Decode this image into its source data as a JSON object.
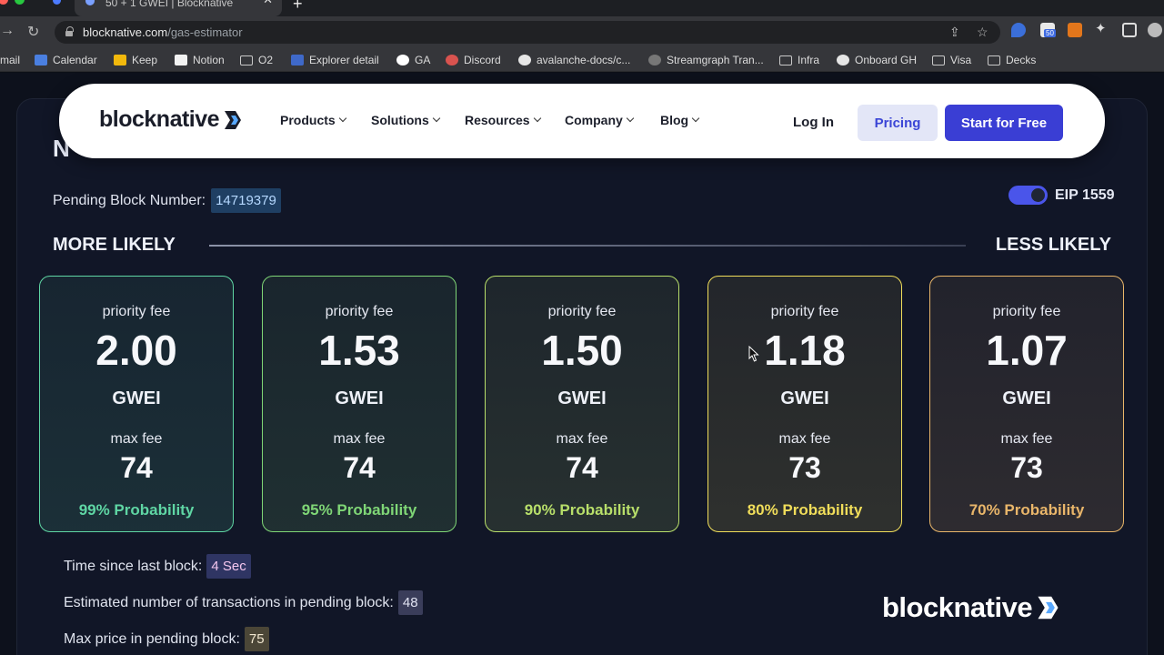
{
  "browser": {
    "tab_title": "50 + 1 GWEI | Blocknative",
    "url_host": "blocknative.com",
    "url_path": "/gas-estimator",
    "extension_badge": "50",
    "bookmarks": [
      {
        "label": "mail",
        "icon": "gmail-icon"
      },
      {
        "label": "Calendar",
        "icon": "calendar-icon"
      },
      {
        "label": "Keep",
        "icon": "keep-icon"
      },
      {
        "label": "Notion",
        "icon": "notion-icon"
      },
      {
        "label": "O2",
        "icon": "folder-icon"
      },
      {
        "label": "Explorer detail",
        "icon": "explorer-icon"
      },
      {
        "label": "GA",
        "icon": "google-icon"
      },
      {
        "label": "Discord",
        "icon": "discord-icon"
      },
      {
        "label": "avalanche-docs/c...",
        "icon": "github-icon"
      },
      {
        "label": "Streamgraph Tran...",
        "icon": "streamgraph-icon"
      },
      {
        "label": "Infra",
        "icon": "folder-icon"
      },
      {
        "label": "Onboard GH",
        "icon": "github-icon"
      },
      {
        "label": "Visa",
        "icon": "folder-icon"
      },
      {
        "label": "Decks",
        "icon": "folder-icon"
      }
    ]
  },
  "nav": {
    "logo": "blocknative",
    "links": [
      "Products",
      "Solutions",
      "Resources",
      "Company",
      "Blog"
    ],
    "login": "Log In",
    "pricing": "Pricing",
    "start": "Start for Free"
  },
  "page": {
    "heading_partial": "N",
    "pending_label": "Pending Block Number:",
    "pending_value": "14719379",
    "eip_label": "EIP 1559",
    "more_likely": "MORE LIKELY",
    "less_likely": "LESS LIKELY"
  },
  "cards": [
    {
      "pf_label": "priority fee",
      "pf": "2.00",
      "unit": "GWEI",
      "mf_label": "max fee",
      "mf": "74",
      "prob": "99% Probability",
      "color": "#5fd6a4"
    },
    {
      "pf_label": "priority fee",
      "pf": "1.53",
      "unit": "GWEI",
      "mf_label": "max fee",
      "mf": "74",
      "prob": "95% Probability",
      "color": "#7fd676"
    },
    {
      "pf_label": "priority fee",
      "pf": "1.50",
      "unit": "GWEI",
      "mf_label": "max fee",
      "mf": "74",
      "prob": "90% Probability",
      "color": "#b8df6a"
    },
    {
      "pf_label": "priority fee",
      "pf": "1.18",
      "unit": "GWEI",
      "mf_label": "max fee",
      "mf": "73",
      "prob": "80% Probability",
      "color": "#f0dd5a"
    },
    {
      "pf_label": "priority fee",
      "pf": "1.07",
      "unit": "GWEI",
      "mf_label": "max fee",
      "mf": "73",
      "prob": "70% Probability",
      "color": "#e9b66a"
    }
  ],
  "stats": {
    "time_label": "Time since last block:",
    "time_value": "4 Sec",
    "tx_label": "Estimated number of transactions in pending block:",
    "tx_value": "48",
    "max_label": "Max price in pending block:",
    "max_value": "75"
  },
  "watermark": "blocknative"
}
